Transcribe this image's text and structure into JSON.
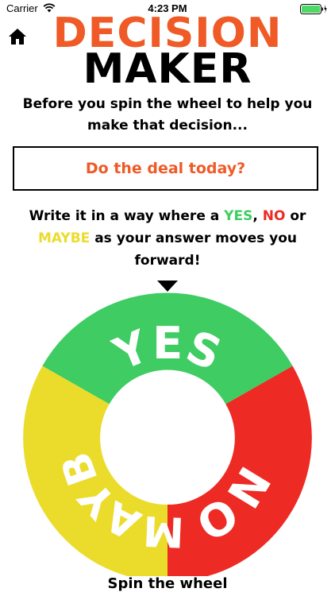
{
  "status_bar": {
    "carrier": "Carrier",
    "time": "4:23 PM"
  },
  "header": {
    "home_icon": "home-icon",
    "title_line1": "DECISION",
    "title_line2": "MAKER"
  },
  "intro_text": "Before you spin the wheel to help you make that decision...",
  "decision_input": {
    "value": "Do the deal today?"
  },
  "instruction": {
    "part1": "Write it in a way where a ",
    "yes": "YES",
    "sep1": ", ",
    "no": "NO",
    "part2": " or ",
    "maybe": "MAYBE",
    "part3": " as your answer moves you forward!"
  },
  "wheel": {
    "segments": [
      {
        "label": "YES",
        "color": "#3ecc63"
      },
      {
        "label": "NO",
        "color": "#ee2a24"
      },
      {
        "label": "MAYBE",
        "color": "#ebdc2c"
      }
    ],
    "pointer_icon": "pointer-triangle-icon"
  },
  "spin_label": "Spin the wheel",
  "colors": {
    "accent": "#ef5a27",
    "yes": "#3ecc63",
    "no": "#ee2a24",
    "maybe": "#ebdc2c"
  }
}
